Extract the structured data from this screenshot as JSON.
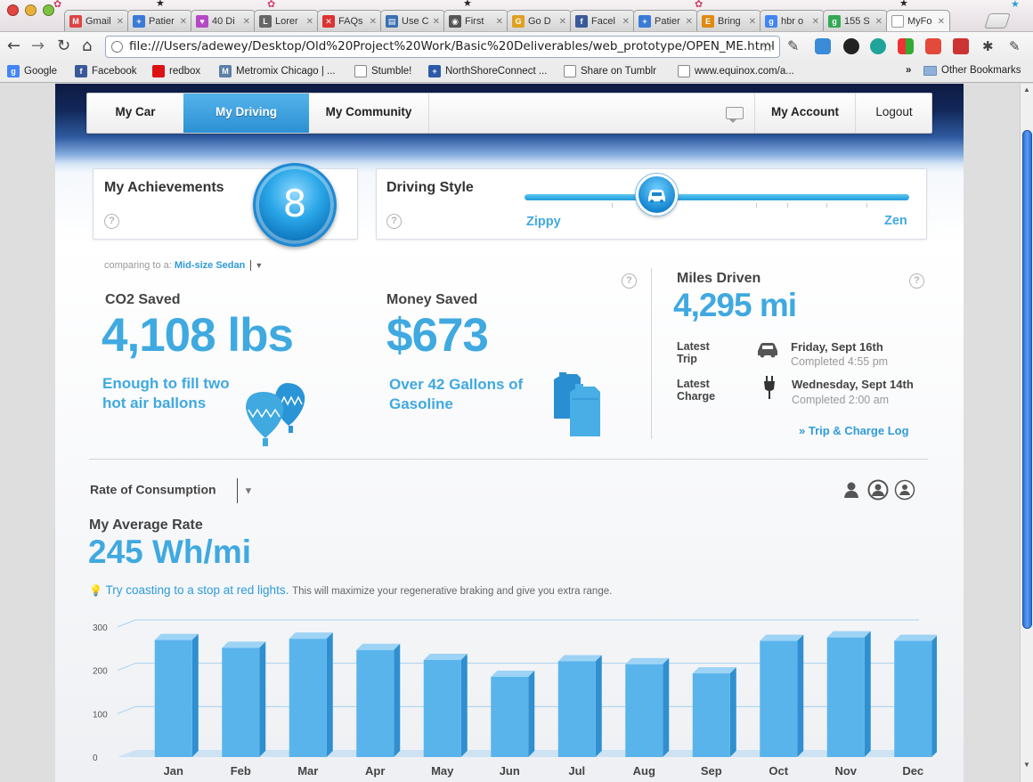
{
  "browser": {
    "tabs": [
      {
        "title": "Gmail",
        "fav": "#d44",
        "ch": "M"
      },
      {
        "title": "Patier",
        "fav": "#3a7bd5",
        "ch": "+"
      },
      {
        "title": "40 Di",
        "fav": "#b548c6",
        "ch": "♥"
      },
      {
        "title": "Lorer",
        "fav": "#666",
        "ch": "L"
      },
      {
        "title": "FAQs",
        "fav": "#d33",
        "ch": "✕"
      },
      {
        "title": "Use C",
        "fav": "#3a6fb0",
        "ch": "▤"
      },
      {
        "title": "First",
        "fav": "#555",
        "ch": "◉"
      },
      {
        "title": "Go D",
        "fav": "#e0a020",
        "ch": "G"
      },
      {
        "title": "Facel",
        "fav": "#3b5998",
        "ch": "f"
      },
      {
        "title": "Patier",
        "fav": "#3a7bd5",
        "ch": "+"
      },
      {
        "title": "Bring",
        "fav": "#e08a10",
        "ch": "E"
      },
      {
        "title": "hbr o",
        "fav": "#4285f4",
        "ch": "g"
      },
      {
        "title": "155 S",
        "fav": "#34a853",
        "ch": "g"
      },
      {
        "title": "MyFo",
        "fav": "#ffffff",
        "ch": ""
      }
    ],
    "url": "file:///Users/adewey/Desktop/Old%20Project%20Work/Basic%20Deliverables/web_prototype/OPEN_ME.html",
    "bookmarks": [
      "Google",
      "Facebook",
      "redbox",
      "Metromix Chicago | ...",
      "Stumble!",
      "NorthShoreConnect ...",
      "Share on Tumblr",
      "www.equinox.com/a...",
      "Other Bookmarks"
    ]
  },
  "nav": {
    "tabs": [
      "My Car",
      "My Driving",
      "My Community"
    ],
    "account": "My Account",
    "logout": "Logout"
  },
  "achievements": {
    "title": "My Achievements",
    "count": "8"
  },
  "driving_style": {
    "title": "Driving Style",
    "left": "Zippy",
    "right": "Zen",
    "position": 0.34
  },
  "comparison": {
    "prefix": "comparing to a:",
    "value": "Mid-size Sedan"
  },
  "co2": {
    "label": "CO2 Saved",
    "value": "4,108 lbs",
    "line1": "Enough to fill two",
    "line2": "hot air ballons"
  },
  "money": {
    "label": "Money Saved",
    "value": "$673",
    "line1": "Over 42 Gallons of",
    "line2": "Gasoline"
  },
  "miles": {
    "label": "Miles Driven",
    "value": "4,295 mi",
    "trip_label1": "Latest",
    "trip_label2": "Trip",
    "trip_date": "Friday, Sept 16th",
    "trip_time": "Completed 4:55 pm",
    "charge_label1": "Latest",
    "charge_label2": "Charge",
    "charge_date": "Wednesday, Sept 14th",
    "charge_time": "Completed 2:00 am",
    "log_link": "Trip & Charge Log"
  },
  "consumption": {
    "selector": "Rate of Consumption",
    "avg_label": "My Average Rate",
    "avg_value": "245 Wh/mi",
    "tip_link": "Try coasting to a stop at red lights.",
    "tip_text": "This will maximize your regenerative braking and give you extra range."
  },
  "chart_data": {
    "type": "bar",
    "categories": [
      "Jan",
      "Feb",
      "Mar",
      "Apr",
      "May",
      "Jun",
      "Jul",
      "Aug",
      "Sep",
      "Oct",
      "Nov",
      "Dec"
    ],
    "values": [
      270,
      252,
      273,
      247,
      224,
      185,
      221,
      214,
      193,
      268,
      276,
      268
    ],
    "ylim": [
      0,
      300
    ],
    "yticks": [
      0,
      100,
      200,
      300
    ],
    "color": "#5ab4ec"
  }
}
